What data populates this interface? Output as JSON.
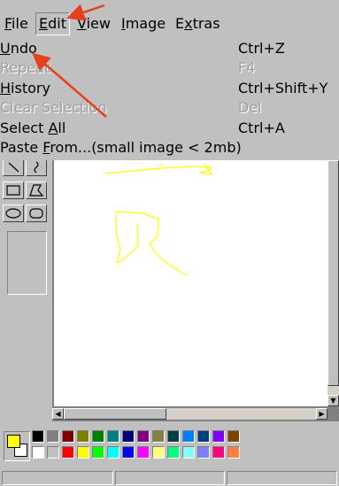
{
  "menubar": {
    "items": [
      {
        "label": "File",
        "mnemonic": "F",
        "rest": "ile"
      },
      {
        "label": "Edit",
        "mnemonic": "E",
        "rest": "dit"
      },
      {
        "label": "View",
        "mnemonic": "V",
        "rest": "iew"
      },
      {
        "label": "Image",
        "mnemonic": "I",
        "rest": "mage"
      },
      {
        "label": "Extras",
        "mnemonic": "x",
        "before": "E",
        "rest": "tras"
      }
    ]
  },
  "edit_menu": {
    "items": [
      {
        "label": "Undo",
        "shortcut": "Ctrl+Z",
        "enabled": true
      },
      {
        "label": "Repeat",
        "shortcut": "F4",
        "enabled": false
      },
      {
        "label": "History",
        "shortcut": "Ctrl+Shift+Y",
        "enabled": true
      },
      {
        "label": "Clear Selection",
        "shortcut": "Del",
        "enabled": false
      },
      {
        "label": "Select All",
        "shortcut": "Ctrl+A",
        "enabled": true
      },
      {
        "label": "Paste From...(small image < 2mb)",
        "shortcut": "",
        "enabled": true
      }
    ]
  },
  "palette": {
    "foreground": "#ffff00",
    "background": "#ffffff",
    "row1": [
      "#000000",
      "#808080",
      "#800000",
      "#808000",
      "#008000",
      "#008080",
      "#000080",
      "#800080",
      "#808040",
      "#004040",
      "#0080ff",
      "#004080",
      "#8000ff",
      "#804000"
    ],
    "row2": [
      "#ffffff",
      "#c0c0c0",
      "#ff0000",
      "#ffff00",
      "#00ff00",
      "#00ffff",
      "#0000ff",
      "#ff00ff",
      "#ffff80",
      "#00ff80",
      "#80ffff",
      "#8080ff",
      "#ff0080",
      "#ff8040"
    ]
  },
  "colors": {
    "drawing_stroke": "#ffff00",
    "annotation_arrow": "#e8401c",
    "face": "#c0c0c0"
  }
}
